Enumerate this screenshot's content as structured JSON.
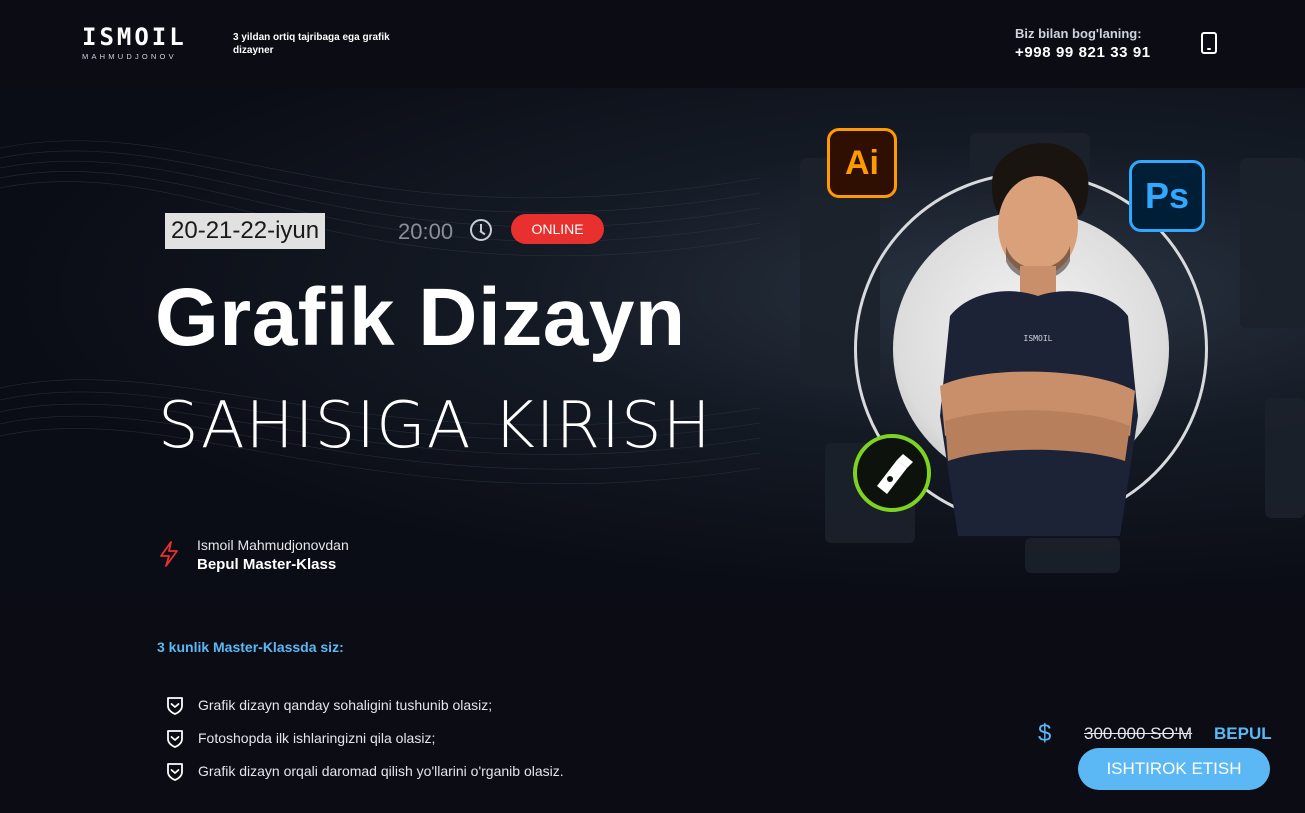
{
  "header": {
    "logo_main": "ISMOIL",
    "logo_sub": "MAHMUDJONOV",
    "tagline": "3 yildan ortiq tajribaga ega grafik dizayner",
    "contact_label": "Biz bilan bog'laning:",
    "contact_phone": "+998 99 821 33 91",
    "phone_icon": "mobile-phone-icon"
  },
  "hero": {
    "date": "20-21-22-iyun",
    "time": "20:00",
    "clock_icon": "clock-icon",
    "mode_badge": "ONLINE",
    "title": "Grafik Dizayn",
    "subtitle": "SAHISIGA KIRISH",
    "author_line": "Ismoil Mahmudjonovdan",
    "author_bold": "Bepul Master-Klass",
    "ai_badge": "Ai",
    "ps_badge": "Ps",
    "shirt_logo": "ISMOIL",
    "colors": {
      "online": "#e8302f",
      "accent": "#5bb8f5",
      "ai": "#ff9a00",
      "ps": "#31a8ff",
      "pen": "#7ed321"
    }
  },
  "features": {
    "heading": "3 kunlik Master-Klassda siz:",
    "items": [
      "Grafik dizayn qanday sohaligini tushunib olasiz;",
      "Fotoshopda ilk ishlaringizni qila olasiz;",
      "Grafik dizayn orqali daromad qilish yo'llarini o'rganib olasiz."
    ]
  },
  "pricing": {
    "currency_icon": "dollar-icon",
    "old_price": "300.000 SO'M",
    "free_label": "BEPUL",
    "cta": "ISHTIROK ETISH"
  }
}
